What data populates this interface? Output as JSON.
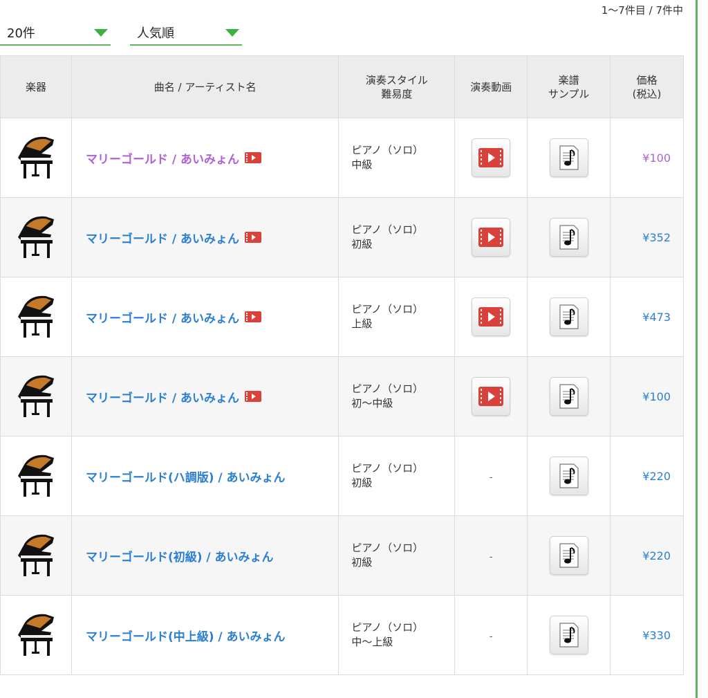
{
  "result_count": "1〜7件目 / 7件中",
  "count_select": "20件",
  "sort_select": "人気順",
  "headers": {
    "instrument": "楽器",
    "title": "曲名 / アーティスト名",
    "style_l1": "演奏スタイル",
    "style_l2": "難易度",
    "video": "演奏動画",
    "sample_l1": "楽譜",
    "sample_l2": "サンプル",
    "price_l1": "価格",
    "price_l2": "(税込)"
  },
  "rows": [
    {
      "title": "マリーゴールド / あいみょん",
      "style": "ピアノ（ソロ）",
      "level": "中級",
      "video": "▶",
      "price": "¥100"
    },
    {
      "title": "マリーゴールド / あいみょん",
      "style": "ピアノ（ソロ）",
      "level": "初級",
      "video": "▶",
      "price": "¥352"
    },
    {
      "title": "マリーゴールド / あいみょん",
      "style": "ピアノ（ソロ）",
      "level": "上級",
      "video": "▶",
      "price": "¥473"
    },
    {
      "title": "マリーゴールド / あいみょん",
      "style": "ピアノ（ソロ）",
      "level": "初〜中級",
      "video": "▶",
      "price": "¥100"
    },
    {
      "title": "マリーゴールド(ハ調版) / あいみょん",
      "style": "ピアノ（ソロ）",
      "level": "初級",
      "video": "-",
      "price": "¥220"
    },
    {
      "title": "マリーゴールド(初級) / あいみょん",
      "style": "ピアノ（ソロ）",
      "level": "初級",
      "video": "-",
      "price": "¥220"
    },
    {
      "title": "マリーゴールド(中上級) / あいみょん",
      "style": "ピアノ（ソロ）",
      "level": "中〜上級",
      "video": "-",
      "price": "¥330"
    }
  ],
  "icons": {
    "instrument": "grand-piano-icon",
    "video": "video-play-icon",
    "sample": "sheet-music-icon",
    "arrow": "chevron-down-icon"
  },
  "colors": {
    "accent_green": "#5cb85c",
    "link_blue": "#2a7fd4",
    "visited_purple": "#b060d8",
    "video_red": "#d9413a"
  }
}
